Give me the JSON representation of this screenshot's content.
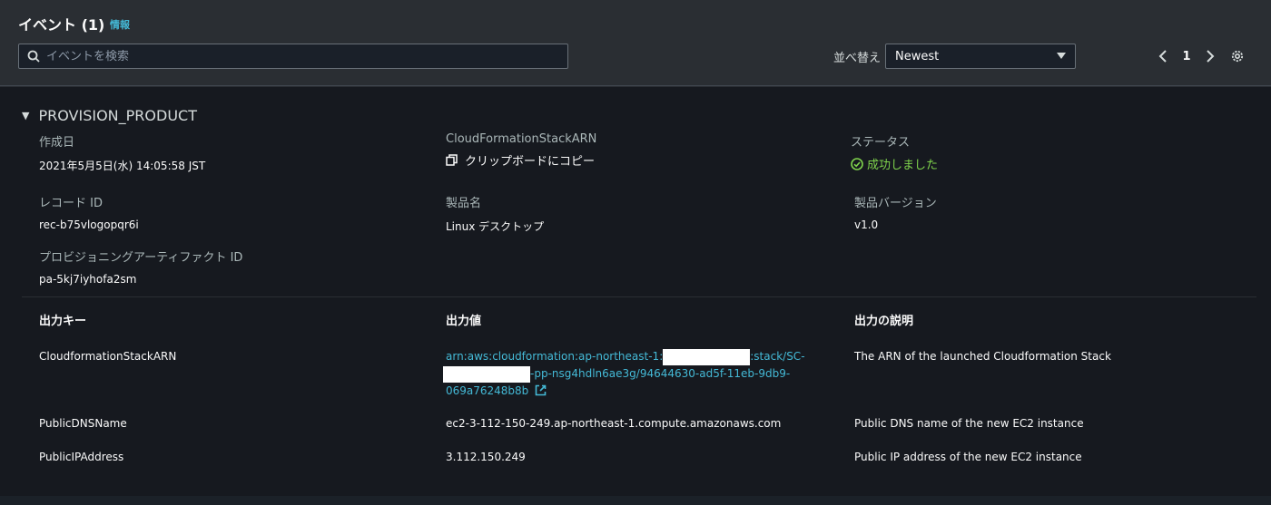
{
  "header": {
    "title": "イベント (1)",
    "info_link": "情報",
    "search_placeholder": "イベントを検索",
    "sort_label": "並べ替え",
    "sort_value": "Newest",
    "page_number": "1"
  },
  "event": {
    "name": "PROVISION_PRODUCT",
    "fields": {
      "created_label": "作成日",
      "created_value": "2021年5月5日(水) 14:05:58 JST",
      "stack_arn_label": "CloudFormationStackARN",
      "copy_label": "クリップボードにコピー",
      "status_label": "ステータス",
      "status_value": "成功しました",
      "record_id_label": "レコード ID",
      "record_id_value": "rec-b75vlogopqr6i",
      "product_name_label": "製品名",
      "product_name_value": "Linux デスクトップ",
      "product_version_label": "製品バージョン",
      "product_version_value": "v1.0",
      "artifact_id_label": "プロビジョニングアーティファクト ID",
      "artifact_id_value": "pa-5kj7iyhofa2sm"
    },
    "outputs": {
      "headers": [
        "出力キー",
        "出力値",
        "出力の説明"
      ],
      "rows": [
        {
          "key": "CloudformationStackARN",
          "value_part1": "arn:aws:cloudformation:ap-northeast-1:",
          "value_part2": ":stack/SC-",
          "value_part3": "-pp-nsg4hdln6ae3g/94644630-ad5f-11eb-9db9-",
          "value_part4": "069a76248b8b",
          "description": "The ARN of the launched Cloudformation Stack"
        },
        {
          "key": "PublicDNSName",
          "value": "ec2-3-112-150-249.ap-northeast-1.compute.amazonaws.com",
          "description": "Public DNS name of the new EC2 instance"
        },
        {
          "key": "PublicIPAddress",
          "value": "3.112.150.249",
          "description": "Public IP address of the new EC2 instance"
        }
      ]
    }
  },
  "colors": {
    "link": "#44b9d6",
    "success": "#7fd34c",
    "background": "#16191f",
    "header_bg": "#2a2e33"
  }
}
